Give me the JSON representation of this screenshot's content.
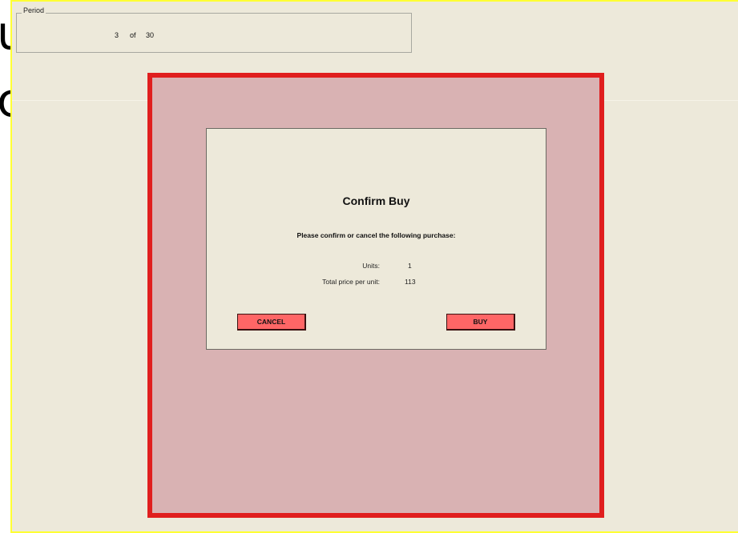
{
  "background": {
    "glyph_top": "u",
    "glyph_mid": "c"
  },
  "period": {
    "legend": "Period",
    "current": "3",
    "separator": "of",
    "total": "30"
  },
  "dialog": {
    "title": "Confirm Buy",
    "message": "Please confirm or cancel the following purchase:",
    "units_label": "Units:",
    "units_value": "1",
    "price_label": "Total price per unit:",
    "price_value": "113",
    "cancel_label": "CANCEL",
    "buy_label": "BUY"
  },
  "colors": {
    "panel_background": "#ede9da",
    "frame_border": "#ffff33",
    "overlay_border": "#e01e1e",
    "overlay_fill": "#d9b2b3",
    "button_fill": "#ff6666"
  }
}
